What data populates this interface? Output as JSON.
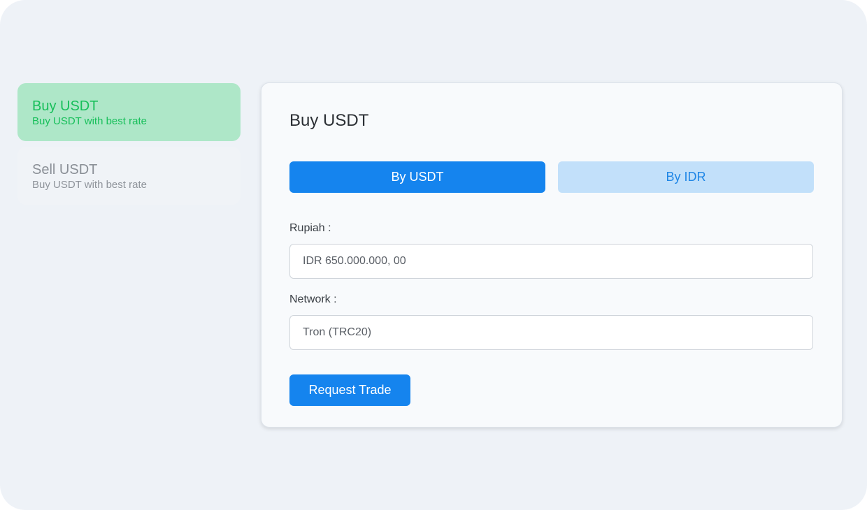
{
  "sidebar": {
    "items": [
      {
        "title": "Buy USDT",
        "subtitle": "Buy USDT with best rate",
        "active": true
      },
      {
        "title": "Sell USDT",
        "subtitle": "Buy USDT with best rate",
        "active": false
      }
    ]
  },
  "card": {
    "title": "Buy USDT",
    "tabs": [
      {
        "label": "By USDT",
        "selected": true
      },
      {
        "label": "By IDR",
        "selected": false
      }
    ],
    "rupiah": {
      "label": "Rupiah :",
      "value": "IDR 650.000.000, 00"
    },
    "network": {
      "label": "Network :",
      "value": "Tron (TRC20)"
    },
    "submit_label": "Request Trade"
  },
  "colors": {
    "accent": "#1584ee",
    "accent_light": "#c2e0fa",
    "success": "#17bf5a",
    "success_bg": "#aee7c8",
    "background": "#eef2f7"
  }
}
